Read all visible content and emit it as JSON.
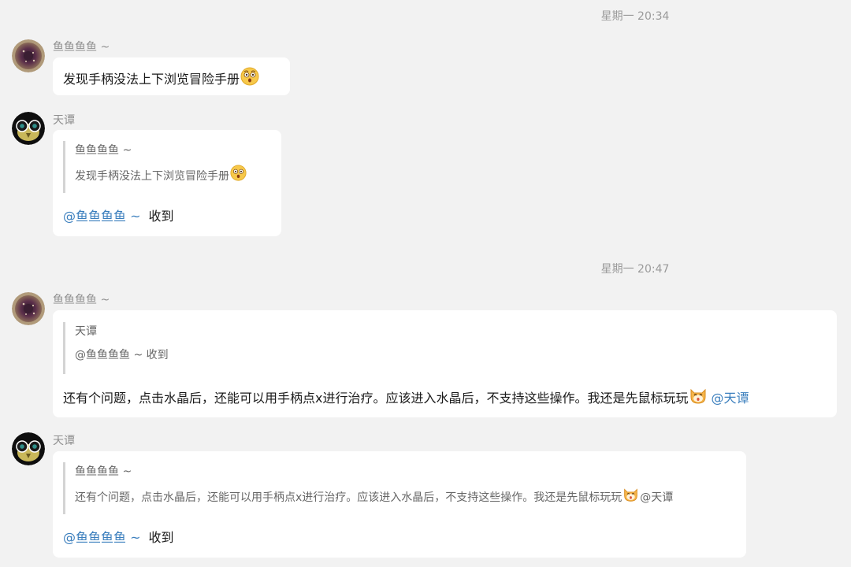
{
  "timestamps": [
    "星期一 20:34",
    "星期一 20:47"
  ],
  "messages": [
    {
      "sender": "鱼鱼鱼鱼 ~",
      "text": "发现手柄没法上下浏览冒险手册",
      "emoji": "surprised-face-emoji"
    },
    {
      "sender": "天谭",
      "quote_sender": "鱼鱼鱼鱼 ~",
      "quote_text": "发现手柄没法上下浏览冒险手册",
      "quote_emoji": "surprised-face-emoji",
      "mention": "@鱼鱼鱼鱼 ~",
      "reply": "收到"
    },
    {
      "sender": "鱼鱼鱼鱼 ~",
      "quote_sender": "天谭",
      "quote_text": "@鱼鱼鱼鱼 ~ 收到",
      "text": "还有个问题，点击水晶后，还能可以用手柄点x进行治疗。应该进入水晶后，不支持这些操作。我还是先鼠标玩玩",
      "emoji": "cat-face-emoji",
      "mention": "@天谭"
    },
    {
      "sender": "天谭",
      "quote_sender": "鱼鱼鱼鱼 ~",
      "quote_text": "还有个问题，点击水晶后，还能可以用手柄点x进行治疗。应该进入水晶后，不支持这些操作。我还是先鼠标玩玩",
      "quote_emoji": "cat-face-emoji",
      "quote_mention": "@天谭",
      "mention": "@鱼鱼鱼鱼 ~",
      "reply": "收到"
    }
  ],
  "colors": {
    "background": "#f2f2f2",
    "bubble": "#ffffff",
    "mention": "#3a7ebd",
    "quote_bar": "#d4d4d4"
  }
}
